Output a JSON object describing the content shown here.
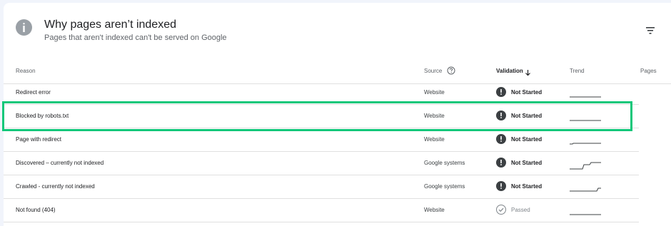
{
  "header": {
    "title": "Why pages aren’t indexed",
    "subtitle": "Pages that aren't indexed can't be served on Google"
  },
  "table": {
    "columns": {
      "reason": "Reason",
      "source": "Source",
      "validation": "Validation",
      "trend": "Trend",
      "pages": "Pages"
    },
    "rows": [
      {
        "reason": "Redirect error",
        "source": "Website",
        "validation": "Not Started",
        "status": "not-started"
      },
      {
        "reason": "Blocked by robots.txt",
        "source": "Website",
        "validation": "Not Started",
        "status": "not-started",
        "highlighted": true
      },
      {
        "reason": "Page with redirect",
        "source": "Website",
        "validation": "Not Started",
        "status": "not-started"
      },
      {
        "reason": "Discovered – currently not indexed",
        "source": "Google systems",
        "validation": "Not Started",
        "status": "not-started"
      },
      {
        "reason": "Crawled - currently not indexed",
        "source": "Google systems",
        "validation": "Not Started",
        "status": "not-started"
      },
      {
        "reason": "Not found (404)",
        "source": "Website",
        "validation": "Passed",
        "status": "passed"
      }
    ]
  },
  "colors": {
    "highlight": "#12c77a",
    "status_dark": "#3c4043",
    "muted": "#80868b"
  }
}
